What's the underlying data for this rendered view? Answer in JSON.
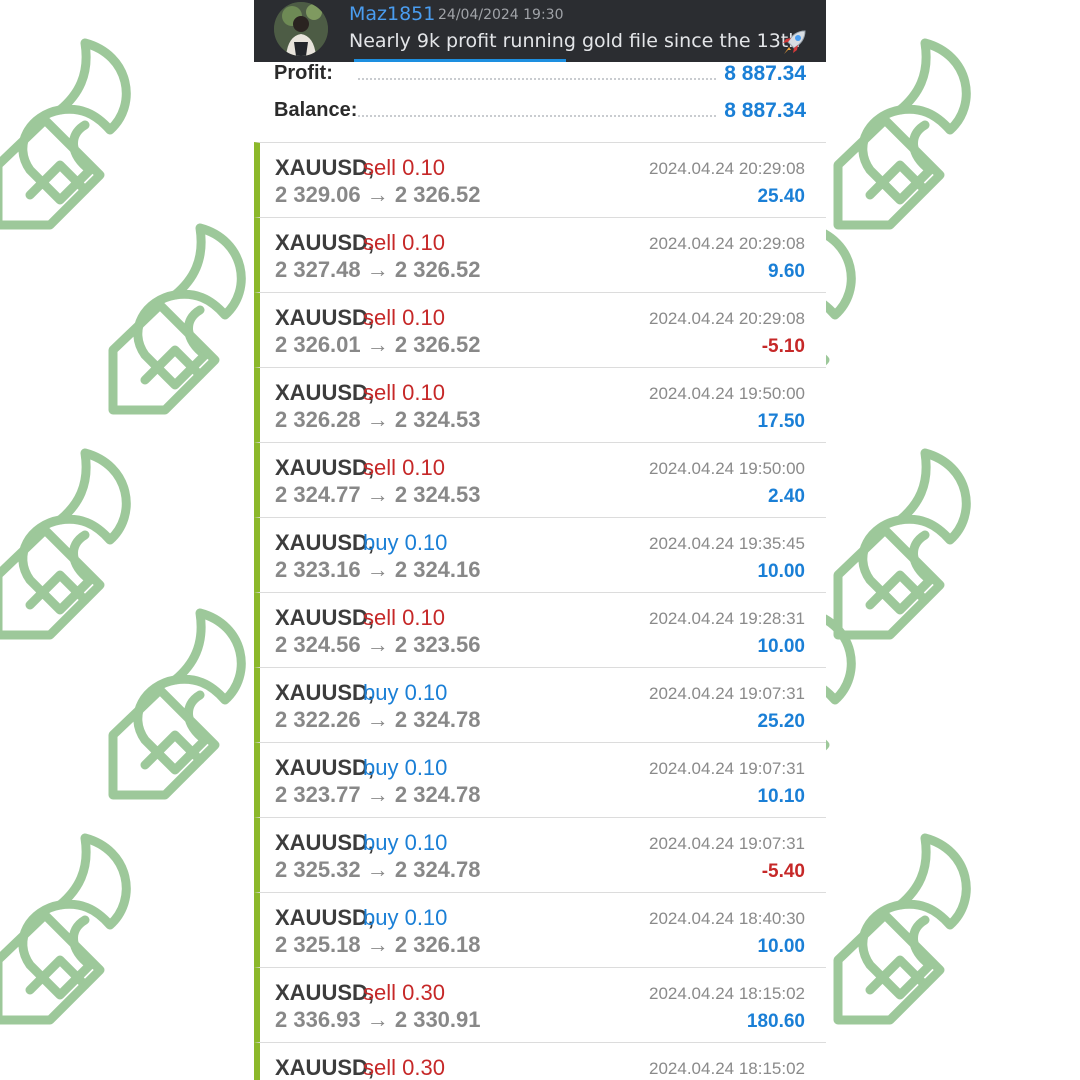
{
  "message": {
    "username": "Maz1851",
    "timestamp": "24/04/2024 19:30",
    "text": "Nearly 9k profit running gold file since the 13th",
    "emoji_icon": "rocket-icon"
  },
  "summary": {
    "profit_label": "Profit:",
    "profit_value": "8 887.34",
    "balance_label": "Balance:",
    "balance_value": "8 887.34"
  },
  "colors": {
    "accent_bar": "#8cb82a",
    "sell": "#c62828",
    "buy": "#1a7fd6",
    "profit_positive": "#1a7fd6",
    "profit_negative": "#c62828",
    "background_logo": "#9dc89a"
  },
  "deals": [
    {
      "symbol": "XAUUSD,",
      "type": "sell 0.10",
      "side": "sell",
      "prices": "2 329.06 → 2 326.52",
      "time": "2024.04.24 20:29:08",
      "profit": "25.40",
      "sign": "pos"
    },
    {
      "symbol": "XAUUSD,",
      "type": "sell 0.10",
      "side": "sell",
      "prices": "2 327.48 → 2 326.52",
      "time": "2024.04.24 20:29:08",
      "profit": "9.60",
      "sign": "pos"
    },
    {
      "symbol": "XAUUSD,",
      "type": "sell 0.10",
      "side": "sell",
      "prices": "2 326.01 → 2 326.52",
      "time": "2024.04.24 20:29:08",
      "profit": "-5.10",
      "sign": "neg"
    },
    {
      "symbol": "XAUUSD,",
      "type": "sell 0.10",
      "side": "sell",
      "prices": "2 326.28 → 2 324.53",
      "time": "2024.04.24 19:50:00",
      "profit": "17.50",
      "sign": "pos"
    },
    {
      "symbol": "XAUUSD,",
      "type": "sell 0.10",
      "side": "sell",
      "prices": "2 324.77 → 2 324.53",
      "time": "2024.04.24 19:50:00",
      "profit": "2.40",
      "sign": "pos"
    },
    {
      "symbol": "XAUUSD,",
      "type": "buy 0.10",
      "side": "buy",
      "prices": "2 323.16 → 2 324.16",
      "time": "2024.04.24 19:35:45",
      "profit": "10.00",
      "sign": "pos"
    },
    {
      "symbol": "XAUUSD,",
      "type": "sell 0.10",
      "side": "sell",
      "prices": "2 324.56 → 2 323.56",
      "time": "2024.04.24 19:28:31",
      "profit": "10.00",
      "sign": "pos"
    },
    {
      "symbol": "XAUUSD,",
      "type": "buy 0.10",
      "side": "buy",
      "prices": "2 322.26 → 2 324.78",
      "time": "2024.04.24 19:07:31",
      "profit": "25.20",
      "sign": "pos"
    },
    {
      "symbol": "XAUUSD,",
      "type": "buy 0.10",
      "side": "buy",
      "prices": "2 323.77 → 2 324.78",
      "time": "2024.04.24 19:07:31",
      "profit": "10.10",
      "sign": "pos"
    },
    {
      "symbol": "XAUUSD,",
      "type": "buy 0.10",
      "side": "buy",
      "prices": "2 325.32 → 2 324.78",
      "time": "2024.04.24 19:07:31",
      "profit": "-5.40",
      "sign": "neg"
    },
    {
      "symbol": "XAUUSD,",
      "type": "buy 0.10",
      "side": "buy",
      "prices": "2 325.18 → 2 326.18",
      "time": "2024.04.24 18:40:30",
      "profit": "10.00",
      "sign": "pos"
    },
    {
      "symbol": "XAUUSD,",
      "type": "sell 0.30",
      "side": "sell",
      "prices": "2 336.93 → 2 330.91",
      "time": "2024.04.24 18:15:02",
      "profit": "180.60",
      "sign": "pos"
    },
    {
      "symbol": "XAUUSD,",
      "type": "sell 0.30",
      "side": "sell",
      "prices": "",
      "time": "2024.04.24 18:15:02",
      "profit": "",
      "sign": "pos"
    }
  ]
}
